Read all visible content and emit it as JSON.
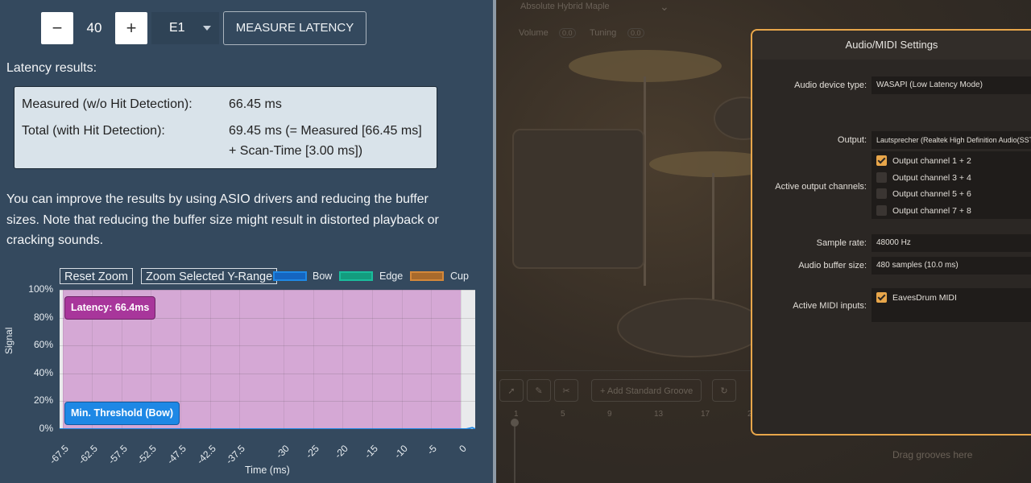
{
  "latency_panel": {
    "controls": {
      "minus": "−",
      "value": "40",
      "plus": "+",
      "note_select": "E1",
      "measure_button": "MEASURE LATENCY"
    },
    "results_title": "Latency results:",
    "results": {
      "measured_label": "Measured (w/o Hit Detection):",
      "measured_value": "66.45 ms",
      "total_label": "Total (with Hit Detection):",
      "total_value": "69.45 ms (= Measured [66.45 ms] + Scan-Time [3.00 ms])"
    },
    "note": "You can improve the results by using ASIO drivers and reducing the buffer sizes. Note that reducing the buffer size might result in distorted playback or cracking sounds.",
    "chart_buttons": {
      "reset_zoom": "Reset Zoom",
      "zoom_y": "Zoom Selected Y-Range"
    },
    "latency_tag": "Latency: 66.4ms",
    "threshold_tag": "Min. Threshold (Bow)"
  },
  "chart_data": {
    "type": "line",
    "xlabel": "Time (ms)",
    "ylabel": "Signal",
    "x_ticks": [
      "-67.5",
      "-62.5",
      "-57.5",
      "-52.5",
      "-47.5",
      "-42.5",
      "-37.5",
      "-30",
      "-25",
      "-20",
      "-15",
      "-10",
      "-5",
      "0"
    ],
    "y_ticks": [
      "100%",
      "80%",
      "60%",
      "40%",
      "20%",
      "0%"
    ],
    "xlim": [
      -68,
      2.5
    ],
    "ylim": [
      0,
      100
    ],
    "series": [
      {
        "name": "Bow",
        "color": "#1e88e5",
        "x": [
          -68,
          0,
          1,
          2,
          2.5
        ],
        "y": [
          0,
          0,
          0,
          1,
          0
        ]
      },
      {
        "name": "Edge",
        "color": "#1abc9c",
        "x": [],
        "y": []
      },
      {
        "name": "Cup",
        "color": "#d4883a",
        "x": [],
        "y": []
      }
    ],
    "highlight_region": {
      "from": -67.5,
      "to": 0,
      "color": "#d5a8d5"
    },
    "grid": true
  },
  "daw": {
    "kit_name": "Absolute Hybrid Maple",
    "volume_label": "Volume",
    "volume_value": "0.0",
    "tuning_label": "Tuning",
    "tuning_value": "0.0",
    "add_groove": "Add Standard Groove",
    "ruler": [
      "1",
      "5",
      "9",
      "13",
      "17",
      "21"
    ],
    "drop_hint": "Drag grooves here"
  },
  "audio_midi_dialog": {
    "title": "Audio/MIDI Settings",
    "device_type_label": "Audio device type:",
    "device_type_value": "WASAPI (Low Latency Mode)",
    "output_label": "Output:",
    "output_value": "Lautsprecher (Realtek High Definition Audio(SST))",
    "active_outputs_label": "Active output channels:",
    "output_channels": [
      {
        "label": "Output channel 1 + 2",
        "checked": true
      },
      {
        "label": "Output channel 3 + 4",
        "checked": false
      },
      {
        "label": "Output channel 5 + 6",
        "checked": false
      },
      {
        "label": "Output channel 7 + 8",
        "checked": false
      }
    ],
    "sample_rate_label": "Sample rate:",
    "sample_rate_value": "48000 Hz",
    "buffer_label": "Audio buffer size:",
    "buffer_value": "480 samples (10.0 ms)",
    "midi_label": "Active MIDI inputs:",
    "midi_inputs": [
      {
        "label": "EavesDrum MIDI",
        "checked": true
      }
    ]
  }
}
